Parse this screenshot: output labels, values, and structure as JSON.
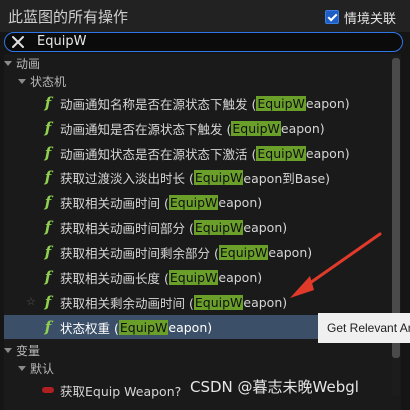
{
  "header": {
    "title": "此蓝图的所有操作",
    "context_label": "情境关联",
    "context_checked": true
  },
  "search": {
    "value": "EquipW"
  },
  "categories": {
    "anim": "动画",
    "state_machine": "状态机",
    "variables": "变量",
    "default": "默认"
  },
  "items": [
    {
      "pre": "动画通知名称是否在源状态下触发 (",
      "hl": "EquipW",
      "post": "eapon)"
    },
    {
      "pre": "动画通知是否在源状态下触发 (",
      "hl": "EquipW",
      "post": "eapon)"
    },
    {
      "pre": "动画通知状态是否在源状态下激活 (",
      "hl": "EquipW",
      "post": "eapon)"
    },
    {
      "pre": "获取过渡淡入淡出时长 (",
      "hl": "EquipW",
      "post": "eapon到Base)"
    },
    {
      "pre": "获取相关动画时间 (",
      "hl": "EquipW",
      "post": "eapon)"
    },
    {
      "pre": "获取相关动画时间部分 (",
      "hl": "EquipW",
      "post": "eapon)"
    },
    {
      "pre": "获取相关动画时间剩余部分 (",
      "hl": "EquipW",
      "post": "eapon)"
    },
    {
      "pre": "获取相关动画长度 (",
      "hl": "EquipW",
      "post": "eapon)"
    },
    {
      "pre": "获取相关剩余动画时间 (",
      "hl": "EquipW",
      "post": "eapon)"
    },
    {
      "pre": "状态权重 (",
      "hl": "EquipW",
      "post": "eapon)"
    }
  ],
  "variable_item": "获取Equip Weapon?",
  "tooltip": "Get Relevant Ar",
  "watermark": "CSDN @暮志未晚Webgl",
  "colors": {
    "highlight": "#6aa02a",
    "selected": "#3b4f68",
    "function_icon": "#8fd14f",
    "annotation_arrow": "#e23a2a",
    "search_border": "#2f77e6"
  },
  "icons": {
    "function": "function-icon",
    "clear": "close-icon",
    "favorite": "star-icon",
    "variable": "variable-pill-icon"
  }
}
